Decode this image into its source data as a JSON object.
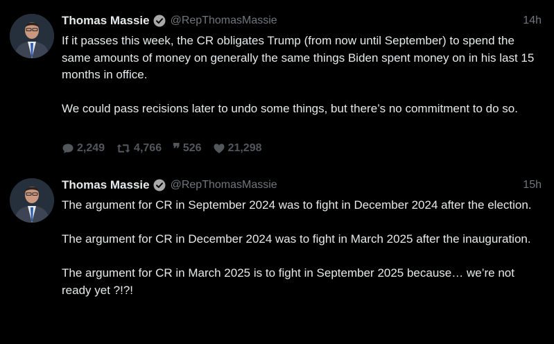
{
  "tweets": [
    {
      "author_name": "Thomas Massie",
      "handle": "@RepThomasMassie",
      "time": "14h",
      "paragraphs": [
        "If it passes this week, the CR obligates Trump (from now until September) to spend the same amounts of money on generally the same things Biden spent money on in his last 15 months in office.",
        "We could pass recisions later to undo some things, but there’s no commitment to do so."
      ],
      "stats": {
        "replies": "2,249",
        "retweets": "4,766",
        "quotes": "526",
        "likes": "21,298"
      },
      "icons": [
        "chat-bubble-icon",
        "retweet-icon",
        "quote-icon",
        "heart-icon"
      ]
    },
    {
      "author_name": "Thomas Massie",
      "handle": "@RepThomasMassie",
      "time": "15h",
      "paragraphs": [
        "The argument for CR in September 2024 was to fight in December 2024 after the election.",
        "The argument for CR in December 2024 was to fight in March 2025 after the inauguration.",
        "The argument for CR in March 2025 is to fight in September 2025 because… we’re not ready yet ?!?!"
      ]
    }
  ],
  "colors": {
    "background": "#000000",
    "text": "#e7e9ea",
    "muted": "#71767b",
    "stats": "#52575c",
    "verified_badge": "#a8a8a8"
  }
}
